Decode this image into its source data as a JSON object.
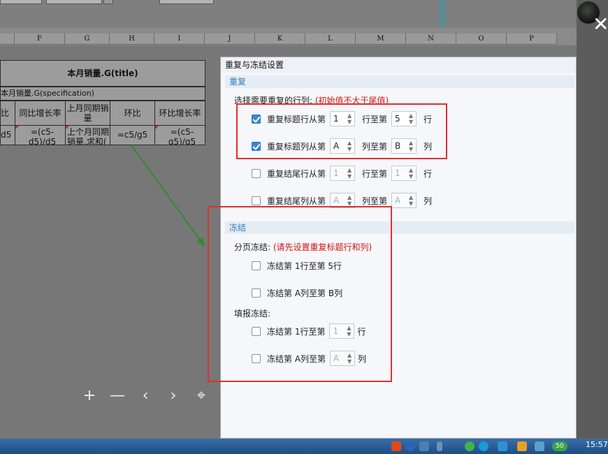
{
  "sheet": {
    "columns": [
      "F",
      "G",
      "H",
      "I",
      "J",
      "K",
      "L",
      "M",
      "N",
      "O",
      "P"
    ],
    "title_cell": "本月销量.G(title)",
    "spec_cell": "本月销量.G(specification)",
    "headers": [
      "比",
      "同比增长率",
      "上月同期销量",
      "环比",
      "环比增长率"
    ],
    "formulas": [
      "d5",
      "=(c5-d5)/d5",
      "上个月同期销量,求和(",
      "=c5/g5",
      "=(c5-g5)/g5"
    ]
  },
  "dialog": {
    "title": "重复与冻结设置",
    "repeat_section": "重复",
    "repeat_hint": "选择需要重复的行列:",
    "repeat_hint_red": "(初始值不大于尾值)",
    "rows": [
      {
        "label": "重复标题行从第",
        "from": "1",
        "mid": "行至第",
        "to": "5",
        "unit": "行",
        "checked": true,
        "enabled": true
      },
      {
        "label": "重复标题列从第",
        "from": "A",
        "mid": "列至第",
        "to": "B",
        "unit": "列",
        "checked": true,
        "enabled": true
      },
      {
        "label": "重复结尾行从第",
        "from": "1",
        "mid": "行至第",
        "to": "1",
        "unit": "行",
        "checked": false,
        "enabled": false
      },
      {
        "label": "重复结尾列从第",
        "from": "A",
        "mid": "列至第",
        "to": "A",
        "unit": "列",
        "checked": false,
        "enabled": false
      }
    ],
    "freeze_section": "冻结",
    "page_freeze_label": "分页冻结:",
    "page_freeze_red": "(请先设置重复标题行和列)",
    "page_freeze_rows": [
      {
        "label": "冻结第  1行至第 5行"
      },
      {
        "label": "冻结第  A列至第 B列"
      }
    ],
    "fill_freeze_label": "填报冻结:",
    "fill_freeze_rows": [
      {
        "label": "冻结第  1行至第",
        "value": "1",
        "unit": "行"
      },
      {
        "label": "冻结第  A列至第",
        "value": "A",
        "unit": "列"
      }
    ]
  },
  "zoombar": [
    "+",
    "—",
    "‹",
    "›",
    "⌖",
    "⟲"
  ],
  "taskbar": {
    "clock": "15:57",
    "badge": "50"
  },
  "colors": {
    "accent": "#3b86d6",
    "highlight_box": "#e03030",
    "arrow": "#2e8b2e"
  }
}
